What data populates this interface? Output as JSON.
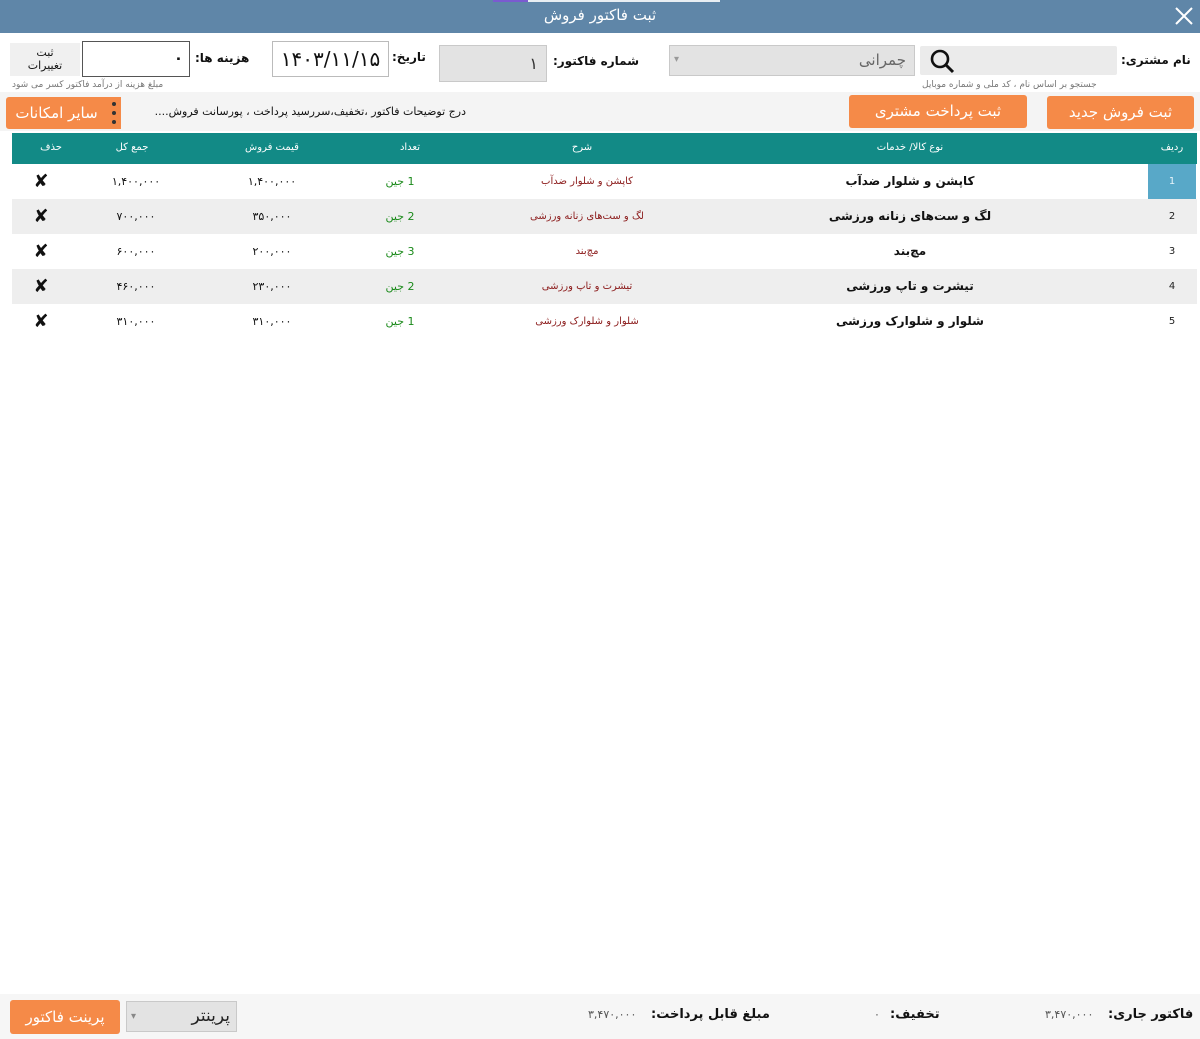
{
  "window": {
    "title": "ثبت فاکتور فروش"
  },
  "customer": {
    "label": "نام مشتری:",
    "hint": "جستجو بر اساس نام ، کد ملی و شماره موبایل",
    "selected": "چمرانی"
  },
  "invoice": {
    "label": "شماره فاکتور:",
    "number": "۱"
  },
  "date": {
    "label": "تاریخ:",
    "value": "۱۴۰۳/۱۱/۱۵"
  },
  "costs": {
    "label": "هزینه ها:",
    "value": "۰",
    "hint": "مبلغ هزینه از درآمد فاکتور کسر می شود",
    "save_line1": "ثبت",
    "save_line2": "تغییرات"
  },
  "toolbar": {
    "new_sale": "ثبت فروش جدید",
    "customer_payment": "ثبت پرداخت مشتری",
    "more_options": "سایر امکانات",
    "description_link": "درج توضیحات فاکتور ،تخفیف،سررسید پرداخت ، پورسانت فروش...."
  },
  "table": {
    "headers": {
      "index": "ردیف",
      "item": "نوع کالا/ خدمات",
      "description": "شرح",
      "quantity": "تعداد",
      "unit_price": "قیمت فروش",
      "total": "جمع کل",
      "delete": "حذف"
    },
    "rows": [
      {
        "index": "1",
        "item": "کاپشن و شلوار ضدآب",
        "description": "کاپشن و شلوار ضدآب",
        "quantity": "1 جین",
        "unit_price": "۱,۴۰۰,۰۰۰",
        "total": "۱,۴۰۰,۰۰۰"
      },
      {
        "index": "2",
        "item": "لگ و ست‌های زنانه ورزشی",
        "description": "لگ و ست‌های زنانه ورزشی",
        "quantity": "2 جین",
        "unit_price": "۳۵۰,۰۰۰",
        "total": "۷۰۰,۰۰۰"
      },
      {
        "index": "3",
        "item": "مچ‌بند",
        "description": "مچ‌بند",
        "quantity": "3 جین",
        "unit_price": "۲۰۰,۰۰۰",
        "total": "۶۰۰,۰۰۰"
      },
      {
        "index": "4",
        "item": "تیشرت و تاپ ورزشی",
        "description": "تیشرت و تاپ ورزشی",
        "quantity": "2 جین",
        "unit_price": "۲۳۰,۰۰۰",
        "total": "۴۶۰,۰۰۰"
      },
      {
        "index": "5",
        "item": "شلوار و شلوارک ورزشی",
        "description": "شلوار و شلوارک ورزشی",
        "quantity": "1 جین",
        "unit_price": "۳۱۰,۰۰۰",
        "total": "۳۱۰,۰۰۰"
      }
    ],
    "delete_glyph": "✘"
  },
  "footer": {
    "current_invoice_label": "فاکتور جاری:",
    "current_invoice_value": "۳,۴۷۰,۰۰۰",
    "discount_label": "تخفیف:",
    "discount_value": "۰",
    "payable_label": "مبلغ قابل پرداخت:",
    "payable_value": "۳,۴۷۰,۰۰۰",
    "printer_label": "پرینتر",
    "print_button": "پرینت فاکتور"
  },
  "colors": {
    "titlebar": "#5f86a8",
    "accent_button": "#f58a48",
    "table_header": "#128a86",
    "selected_index": "#58a8c8"
  }
}
